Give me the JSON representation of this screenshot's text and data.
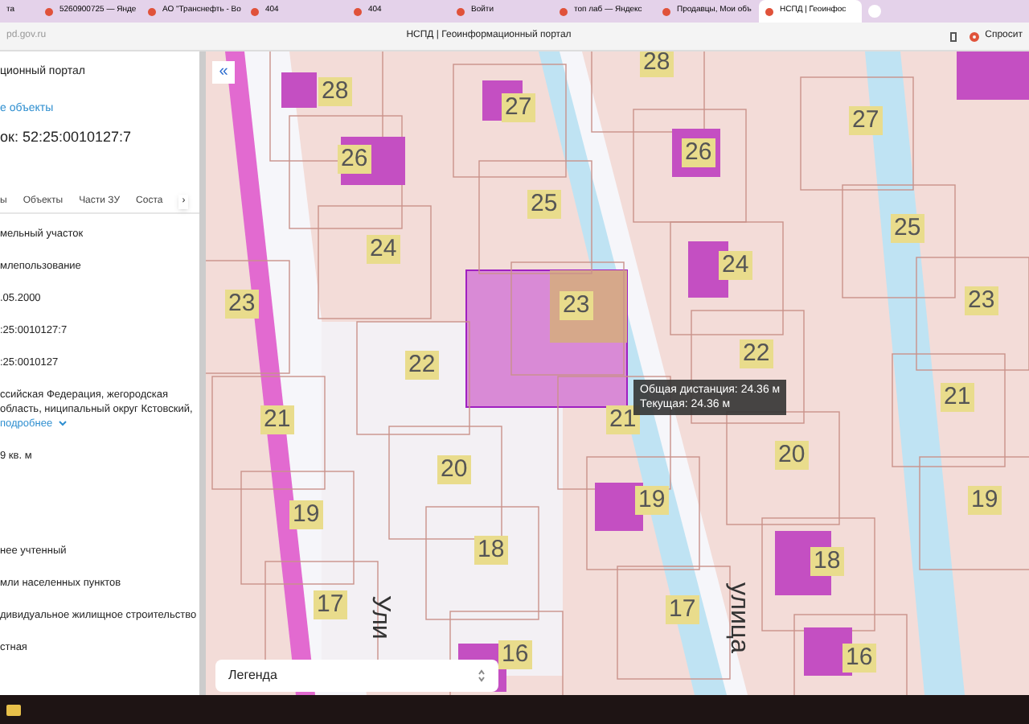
{
  "browser": {
    "tabs": [
      {
        "title": "та",
        "selected": false
      },
      {
        "title": "5260900725 — Янде",
        "selected": false
      },
      {
        "title": "АО \"Транснефть - Во",
        "selected": false
      },
      {
        "title": "404",
        "selected": false
      },
      {
        "title": "404",
        "selected": false
      },
      {
        "title": "Войти",
        "selected": false
      },
      {
        "title": "топ лаб — Яндекс",
        "selected": false
      },
      {
        "title": "Продавцы, Мои объ",
        "selected": false
      },
      {
        "title": "НСПД | Геоинфос",
        "selected": true
      }
    ],
    "address": "pd.gov.ru",
    "page_title": "НСПД | Геоинформационный портал",
    "assistant": "Спросит"
  },
  "panel": {
    "portal": "ционный портал",
    "link": "е объекты",
    "heading": "ок: 52:25:0010127:7",
    "tabs": [
      {
        "label": "ы",
        "selected": false
      },
      {
        "label": "Объекты",
        "selected": false
      },
      {
        "label": "Части ЗУ",
        "selected": false
      },
      {
        "label": "Соста",
        "selected": false
      }
    ],
    "tab_arrow": "›",
    "fields": [
      {
        "kind": "text",
        "value": "мельный участок"
      },
      {
        "kind": "text",
        "value": "млепользование"
      },
      {
        "kind": "text",
        "value": ".05.2000"
      },
      {
        "kind": "text",
        "value": ":25:0010127:7"
      },
      {
        "kind": "text",
        "value": ":25:0010127"
      },
      {
        "kind": "address",
        "value": "ссийская Федерация, жегородская область, ниципальный округ Кстовский,",
        "more": "подробнее"
      },
      {
        "kind": "text",
        "value": "9 кв. м"
      },
      {
        "kind": "gap"
      },
      {
        "kind": "text",
        "value": "нее учтенный"
      },
      {
        "kind": "text",
        "value": "мли населенных пунктов"
      },
      {
        "kind": "text",
        "value": "дивидуальное жилищное строительство"
      },
      {
        "kind": "text",
        "value": "стная"
      }
    ]
  },
  "map": {
    "collapse": "«",
    "parcels": [
      "28",
      "27",
      "26",
      "25",
      "24",
      "23",
      "23",
      "22",
      "21",
      "20",
      "19",
      "18",
      "17",
      "16",
      "28",
      "27",
      "26",
      "25",
      "24",
      "23",
      "22",
      "21",
      "21",
      "20",
      "19",
      "19",
      "18",
      "17",
      "16"
    ],
    "streets": [
      "Ули",
      "улица"
    ],
    "tooltip": {
      "total": "Общая дистанция: 24.36 м",
      "current": "Текущая: 24.36 м"
    },
    "legend": "Легенда"
  }
}
